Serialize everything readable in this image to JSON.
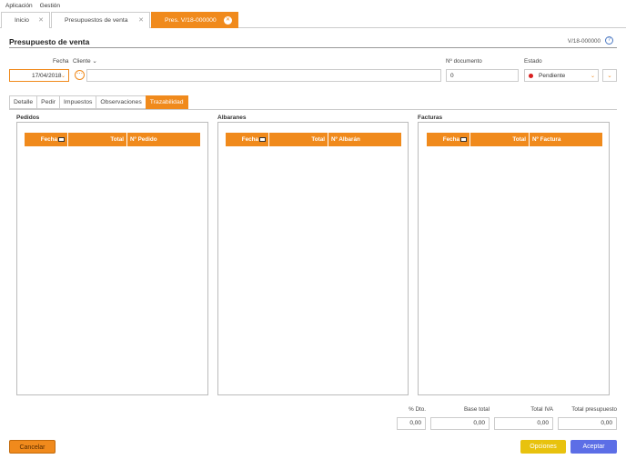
{
  "menu": [
    "Aplicación",
    "Gestión"
  ],
  "tabs": [
    {
      "label": "Inicio"
    },
    {
      "label": "Presupuestos de venta"
    },
    {
      "label": "Pres. V/18-000000"
    }
  ],
  "header": {
    "title": "Presupuesto de venta",
    "doc_ref": "V/18-000000",
    "help": "?"
  },
  "form": {
    "fecha_label": "Fecha",
    "fecha_value": "17/04/2018",
    "cliente_label": "Cliente",
    "cliente_value": "",
    "ndoc_label": "Nº documento",
    "ndoc_value": "0",
    "estado_label": "Estado",
    "estado_value": "Pendiente",
    "status_color": "#d92020"
  },
  "subtabs": [
    "Detalle",
    "Pedir",
    "Impuestos",
    "Observaciones",
    "Trazabilidad"
  ],
  "groups": [
    {
      "title": "Pedidos",
      "cols": [
        "Fecha",
        "Total",
        "Nº Pedido"
      ]
    },
    {
      "title": "Albaranes",
      "cols": [
        "Fecha",
        "Total",
        "Nº Albarán"
      ]
    },
    {
      "title": "Facturas",
      "cols": [
        "Fecha",
        "Total",
        "Nº Factura"
      ]
    }
  ],
  "totals": [
    {
      "label": "% Dto.",
      "value": "0,00"
    },
    {
      "label": "Base total",
      "value": "0,00"
    },
    {
      "label": "Total IVA",
      "value": "0,00"
    },
    {
      "label": "Total presupuesto",
      "value": "0,00"
    }
  ],
  "buttons": {
    "cancel": "Cancelar",
    "options": "Opciones",
    "accept": "Aceptar"
  },
  "colors": {
    "accent": "#f08a1c",
    "options": "#e8c20e",
    "accept": "#5c6ee6"
  }
}
